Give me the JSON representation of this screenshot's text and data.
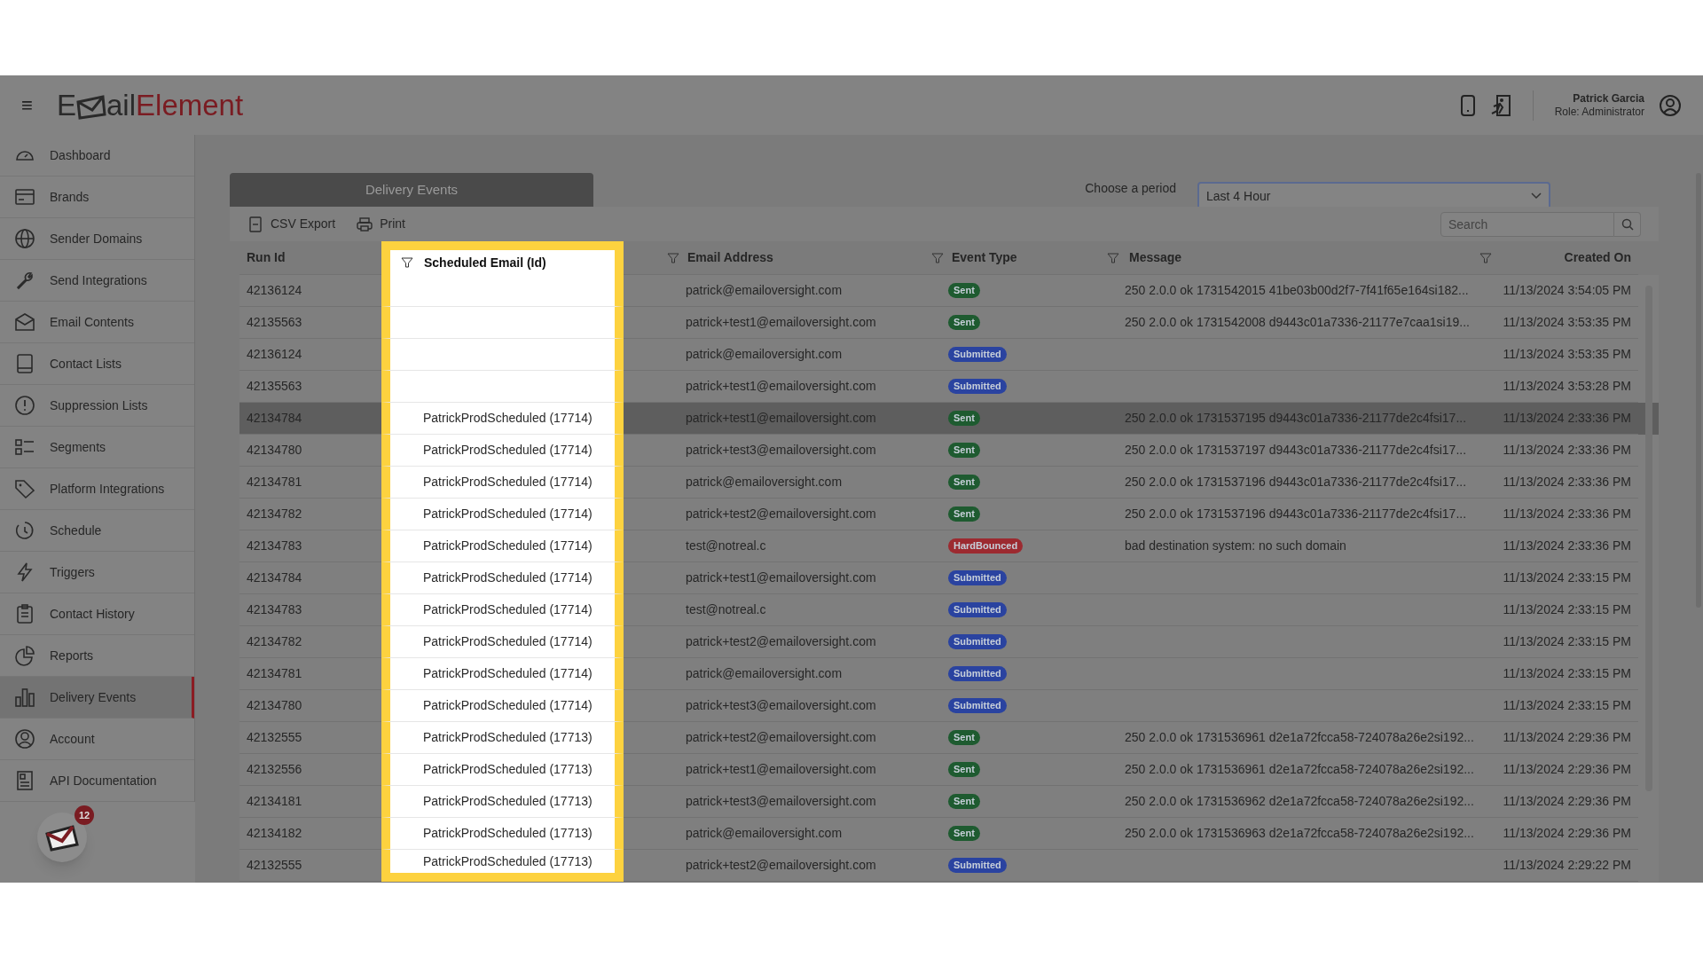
{
  "header": {
    "menu_glyph": "≡",
    "logo": {
      "lead": "E",
      "rest": "ail",
      "accent": "Element"
    },
    "user": {
      "name": "Patrick Garcia",
      "role": "Role: Administrator"
    }
  },
  "sidebar": {
    "items": [
      {
        "label": "Dashboard",
        "selected": false
      },
      {
        "label": "Brands",
        "selected": false
      },
      {
        "label": "Sender Domains",
        "selected": false
      },
      {
        "label": "Send Integrations",
        "selected": false
      },
      {
        "label": "Email Contents",
        "selected": false
      },
      {
        "label": "Contact Lists",
        "selected": false
      },
      {
        "label": "Suppression Lists",
        "selected": false
      },
      {
        "label": "Segments",
        "selected": false
      },
      {
        "label": "Platform Integrations",
        "selected": false
      },
      {
        "label": "Schedule",
        "selected": false
      },
      {
        "label": "Triggers",
        "selected": false
      },
      {
        "label": "Contact History",
        "selected": false
      },
      {
        "label": "Reports",
        "selected": false
      },
      {
        "label": "Delivery Events",
        "selected": true
      },
      {
        "label": "Account",
        "selected": false
      },
      {
        "label": "API Documentation",
        "selected": false
      }
    ],
    "notification_count": "12"
  },
  "panel": {
    "tab": "Delivery Events",
    "period_label": "Choose a period",
    "period_value": "Last 4 Hour",
    "toolbar": [
      "CSV Export",
      "Print"
    ],
    "search": {
      "placeholder": "Search"
    }
  },
  "table": {
    "columns": [
      "Run Id",
      "Scheduled Email (Id)",
      "Email Address",
      "Event Type",
      "Message",
      "Created On"
    ],
    "rows": [
      {
        "run_id": "42136124",
        "scheduled_email": "",
        "email": "patrick@emailoversight.com",
        "event_type": "Sent",
        "color": "#1e5b30",
        "message": "250 2.0.0 ok 1731542015 41be03b00d2f7-7f41f65e164si182...",
        "created_on": "11/13/2024 3:54:05 PM",
        "selected": false
      },
      {
        "run_id": "42135563",
        "scheduled_email": "",
        "email": "patrick+test1@emailoversight.com",
        "event_type": "Sent",
        "color": "#1e5b30",
        "message": "250 2.0.0 ok 1731542008 d9443c01a7336-21177e7caa1si19...",
        "created_on": "11/13/2024 3:53:35 PM",
        "selected": false
      },
      {
        "run_id": "42136124",
        "scheduled_email": "",
        "email": "patrick@emailoversight.com",
        "event_type": "Submitted",
        "color": "#2a43a0",
        "message": "",
        "created_on": "11/13/2024 3:53:35 PM",
        "selected": false
      },
      {
        "run_id": "42135563",
        "scheduled_email": "",
        "email": "patrick+test1@emailoversight.com",
        "event_type": "Submitted",
        "color": "#2a43a0",
        "message": "",
        "created_on": "11/13/2024 3:53:28 PM",
        "selected": false
      },
      {
        "run_id": "42134784",
        "scheduled_email": "PatrickProdScheduled (17714)",
        "email": "patrick+test1@emailoversight.com",
        "event_type": "Sent",
        "color": "#1e5b30",
        "message": "250 2.0.0 ok 1731537195 d9443c01a7336-21177de2c4fsi17...",
        "created_on": "11/13/2024 2:33:36 PM",
        "selected": true
      },
      {
        "run_id": "42134780",
        "scheduled_email": "PatrickProdScheduled (17714)",
        "email": "patrick+test3@emailoversight.com",
        "event_type": "Sent",
        "color": "#1e5b30",
        "message": "250 2.0.0 ok 1731537197 d9443c01a7336-21177de2c4fsi17...",
        "created_on": "11/13/2024 2:33:36 PM",
        "selected": false
      },
      {
        "run_id": "42134781",
        "scheduled_email": "PatrickProdScheduled (17714)",
        "email": "patrick@emailoversight.com",
        "event_type": "Sent",
        "color": "#1e5b30",
        "message": "250 2.0.0 ok 1731537196 d9443c01a7336-21177de2c4fsi17...",
        "created_on": "11/13/2024 2:33:36 PM",
        "selected": false
      },
      {
        "run_id": "42134782",
        "scheduled_email": "PatrickProdScheduled (17714)",
        "email": "patrick+test2@emailoversight.com",
        "event_type": "Sent",
        "color": "#1e5b30",
        "message": "250 2.0.0 ok 1731537196 d9443c01a7336-21177de2c4fsi17...",
        "created_on": "11/13/2024 2:33:36 PM",
        "selected": false
      },
      {
        "run_id": "42134783",
        "scheduled_email": "PatrickProdScheduled (17714)",
        "email": "test@notreal.c",
        "event_type": "HardBounced",
        "color": "#9c2a30",
        "message": "bad destination system: no such domain",
        "created_on": "11/13/2024 2:33:36 PM",
        "selected": false
      },
      {
        "run_id": "42134784",
        "scheduled_email": "PatrickProdScheduled (17714)",
        "email": "patrick+test1@emailoversight.com",
        "event_type": "Submitted",
        "color": "#2a43a0",
        "message": "",
        "created_on": "11/13/2024 2:33:15 PM",
        "selected": false
      },
      {
        "run_id": "42134783",
        "scheduled_email": "PatrickProdScheduled (17714)",
        "email": "test@notreal.c",
        "event_type": "Submitted",
        "color": "#2a43a0",
        "message": "",
        "created_on": "11/13/2024 2:33:15 PM",
        "selected": false
      },
      {
        "run_id": "42134782",
        "scheduled_email": "PatrickProdScheduled (17714)",
        "email": "patrick+test2@emailoversight.com",
        "event_type": "Submitted",
        "color": "#2a43a0",
        "message": "",
        "created_on": "11/13/2024 2:33:15 PM",
        "selected": false
      },
      {
        "run_id": "42134781",
        "scheduled_email": "PatrickProdScheduled (17714)",
        "email": "patrick@emailoversight.com",
        "event_type": "Submitted",
        "color": "#2a43a0",
        "message": "",
        "created_on": "11/13/2024 2:33:15 PM",
        "selected": false
      },
      {
        "run_id": "42134780",
        "scheduled_email": "PatrickProdScheduled (17714)",
        "email": "patrick+test3@emailoversight.com",
        "event_type": "Submitted",
        "color": "#2a43a0",
        "message": "",
        "created_on": "11/13/2024 2:33:15 PM",
        "selected": false
      },
      {
        "run_id": "42132555",
        "scheduled_email": "PatrickProdScheduled (17713)",
        "email": "patrick+test2@emailoversight.com",
        "event_type": "Sent",
        "color": "#1e5b30",
        "message": "250 2.0.0 ok 1731536961 d2e1a72fcca58-724078a26e2si192...",
        "created_on": "11/13/2024 2:29:36 PM",
        "selected": false
      },
      {
        "run_id": "42132556",
        "scheduled_email": "PatrickProdScheduled (17713)",
        "email": "patrick+test1@emailoversight.com",
        "event_type": "Sent",
        "color": "#1e5b30",
        "message": "250 2.0.0 ok 1731536961 d2e1a72fcca58-724078a26e2si192...",
        "created_on": "11/13/2024 2:29:36 PM",
        "selected": false
      },
      {
        "run_id": "42134181",
        "scheduled_email": "PatrickProdScheduled (17713)",
        "email": "patrick+test3@emailoversight.com",
        "event_type": "Sent",
        "color": "#1e5b30",
        "message": "250 2.0.0 ok 1731536962 d2e1a72fcca58-724078a26e2si192...",
        "created_on": "11/13/2024 2:29:36 PM",
        "selected": false
      },
      {
        "run_id": "42134182",
        "scheduled_email": "PatrickProdScheduled (17713)",
        "email": "patrick@emailoversight.com",
        "event_type": "Sent",
        "color": "#1e5b30",
        "message": "250 2.0.0 ok 1731536963 d2e1a72fcca58-724078a26e2si192...",
        "created_on": "11/13/2024 2:29:36 PM",
        "selected": false
      },
      {
        "run_id": "42132555",
        "scheduled_email": "PatrickProdScheduled (17713)",
        "email": "patrick+test2@emailoversight.com",
        "event_type": "Submitted",
        "color": "#2a43a0",
        "message": "",
        "created_on": "11/13/2024 2:29:22 PM",
        "selected": false
      }
    ]
  }
}
